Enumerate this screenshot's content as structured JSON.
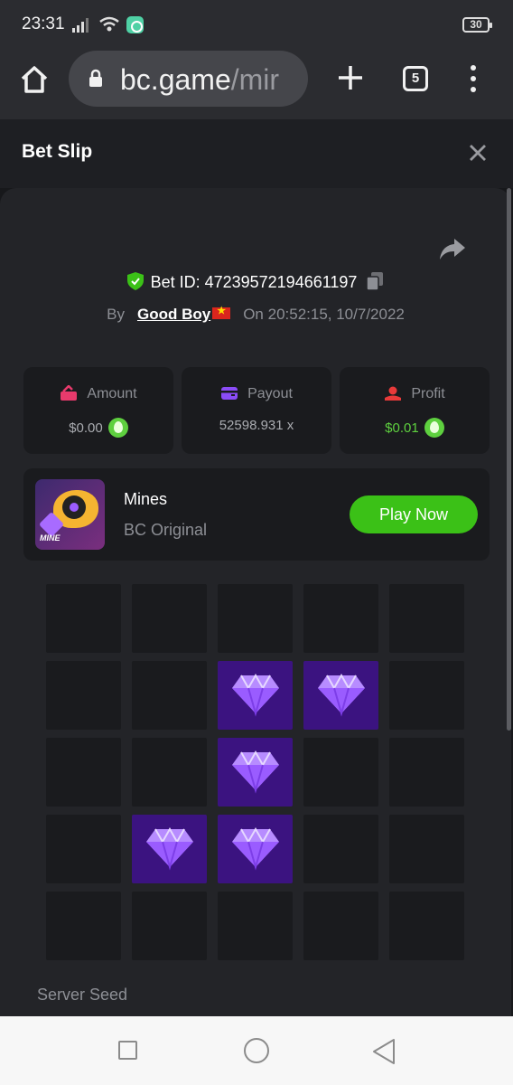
{
  "status_bar": {
    "time": "23:31",
    "battery": "30"
  },
  "browser": {
    "url_host": "bc.game",
    "url_path": "/mir",
    "tab_count": "5"
  },
  "sheet": {
    "title": "Bet Slip"
  },
  "bet": {
    "id_label": "Bet ID: 47239572194661197",
    "by_label": "By",
    "user": "Good Boy",
    "on_label": "On",
    "datetime": "20:52:15, 10/7/2022"
  },
  "stats": {
    "amount_label": "Amount",
    "amount_value": "$0.00",
    "payout_label": "Payout",
    "payout_value": "52598.931 x",
    "profit_label": "Profit",
    "profit_value": "$0.01"
  },
  "game": {
    "thumb_text": "MINE",
    "name": "Mines",
    "provider": "BC Original",
    "play_label": "Play Now"
  },
  "board": {
    "rows": 5,
    "cols": 5,
    "cells": [
      [
        0,
        0,
        0,
        0,
        0
      ],
      [
        0,
        0,
        1,
        1,
        0
      ],
      [
        0,
        0,
        1,
        0,
        0
      ],
      [
        0,
        1,
        1,
        0,
        0
      ],
      [
        0,
        0,
        0,
        0,
        0
      ]
    ]
  },
  "server_seed_label": "Server Seed",
  "colors": {
    "accent_green": "#3bc117",
    "gem_cell": "#3b1380",
    "profit_green": "#5ed03f"
  }
}
